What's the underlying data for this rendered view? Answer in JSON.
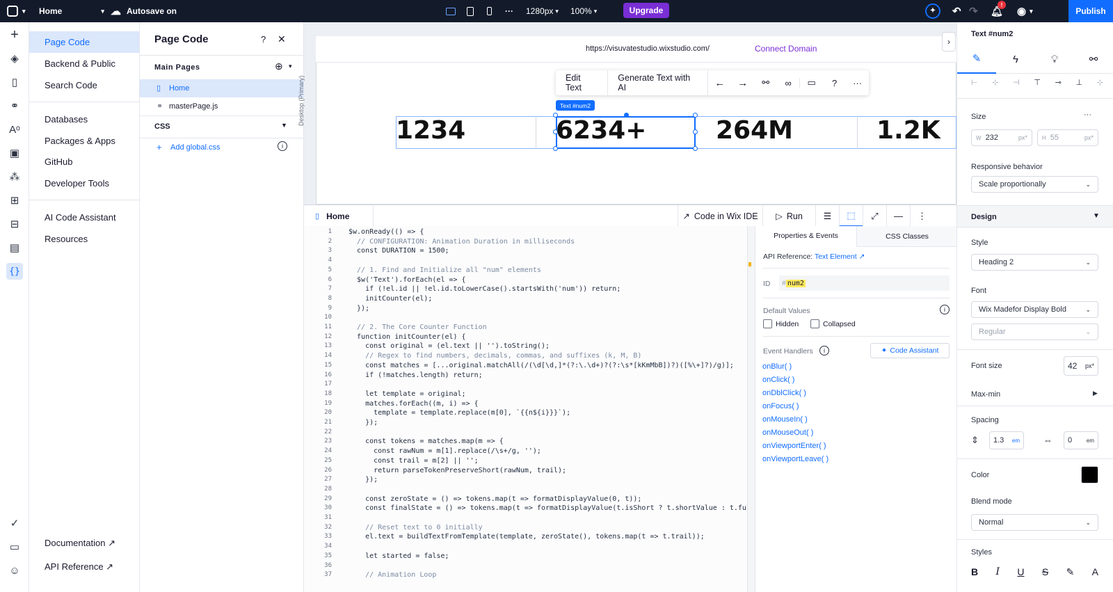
{
  "topbar": {
    "site": "Home",
    "autosave": "Autosave on",
    "breakpoint": "1280px",
    "zoom": "100%",
    "more": "···",
    "upgrade": "Upgrade",
    "publish": "Publish",
    "notif_count": "!"
  },
  "nav": {
    "items": [
      "Page Code",
      "Backend & Public",
      "Search Code",
      "Databases",
      "Packages & Apps",
      "GitHub",
      "Developer Tools",
      "AI Code Assistant",
      "Resources"
    ],
    "footer": [
      "Documentation",
      "API Reference"
    ]
  },
  "page_code": {
    "title": "Page Code",
    "help": "?",
    "close": "✕",
    "main_pages": "Main Pages",
    "pages": [
      "Home",
      "masterPage.js"
    ],
    "css": "CSS",
    "add_css": "Add global.css"
  },
  "canvas": {
    "url": "https://visuvatestudio.wixstudio.com/",
    "connect": "Connect Domain",
    "breakpoint_label": "Desktop (Primary)",
    "toolbar": {
      "edit": "Edit Text",
      "generate": "Generate Text with AI"
    },
    "selection_tag": "Text #num2",
    "numbers": [
      "1234",
      "6234+",
      "264M",
      "1.2K"
    ]
  },
  "editor": {
    "tab": "Home",
    "code_ide": "Code in Wix IDE",
    "run": "Run",
    "tabs": [
      "Properties & Events",
      "CSS Classes"
    ]
  },
  "code_lines": [
    "$w.onReady(() => {",
    "  // CONFIGURATION: Animation Duration in milliseconds",
    "  const DURATION = 1500;",
    "",
    "  // 1. Find and Initialize all \"num\" elements",
    "  $w('Text').forEach(el => {",
    "    if (!el.id || !el.id.toLowerCase().startsWith('num')) return;",
    "    initCounter(el);",
    "  });",
    "",
    "  // 2. The Core Counter Function",
    "  function initCounter(el) {",
    "    const original = (el.text || '').toString();",
    "    // Regex to find numbers, decimals, commas, and suffixes (k, M, B)",
    "    const matches = [...original.matchAll(/(\\d[\\d,]*(?:\\.\\d+)?(?:\\s*[kKmMbB])?)([%\\+]?)/g)];",
    "    if (!matches.length) return;",
    "",
    "    let template = original;",
    "    matches.forEach((m, i) => {",
    "      template = template.replace(m[0], `{{n${i}}}`);",
    "    });",
    "",
    "    const tokens = matches.map(m => {",
    "      const rawNum = m[1].replace(/\\s+/g, '');",
    "      const trail = m[2] || '';",
    "      return parseTokenPreserveShort(rawNum, trail);",
    "    });",
    "",
    "    const zeroState = () => tokens.map(t => formatDisplayValue(0, t));",
    "    const finalState = () => tokens.map(t => formatDisplayValue(t.isShort ? t.shortValue : t.fullValu",
    "",
    "    // Reset text to 0 initially",
    "    el.text = buildTextFromTemplate(template, zeroState(), tokens.map(t => t.trail));",
    "",
    "    let started = false;",
    "",
    "    // Animation Loop"
  ],
  "props": {
    "api_ref": "API Reference:",
    "api_link": "Text Element",
    "id_label": "ID",
    "id_hash": "#",
    "id_value": "num2",
    "defaults": "Default Values",
    "hidden": "Hidden",
    "collapsed": "Collapsed",
    "handlers_label": "Event Handlers",
    "code_assistant": "Code Assistant",
    "handlers": [
      "onBlur( )",
      "onClick( )",
      "onDblClick( )",
      "onFocus( )",
      "onMouseIn( )",
      "onMouseOut( )",
      "onViewportEnter( )",
      "onViewportLeave( )"
    ]
  },
  "inspector": {
    "title": "Text #num2",
    "size": "Size",
    "w_label": "W",
    "w": "232",
    "w_unit": "px*",
    "h_label": "H",
    "h": "55",
    "h_unit": "px*",
    "responsive": "Responsive behavior",
    "responsive_val": "Scale proportionally",
    "design": "Design",
    "style": "Style",
    "style_val": "Heading 2",
    "font": "Font",
    "font_val": "Wix Madefor Display Bold",
    "weight_val": "Regular",
    "font_size": "Font size",
    "font_size_val": "42",
    "font_size_unit": "px*",
    "maxmin": "Max-min",
    "spacing": "Spacing",
    "line_h": "1.3",
    "line_unit": "em",
    "letter": "0",
    "letter_unit": "em",
    "color": "Color",
    "color_val": "#000000",
    "blend": "Blend mode",
    "blend_val": "Normal",
    "styles": "Styles",
    "more": "···"
  },
  "colors": {
    "accent": "#116dff",
    "upgrade": "#7a2ed6",
    "topbar": "#131b2b",
    "nav_selected": "#dbe7fb"
  }
}
